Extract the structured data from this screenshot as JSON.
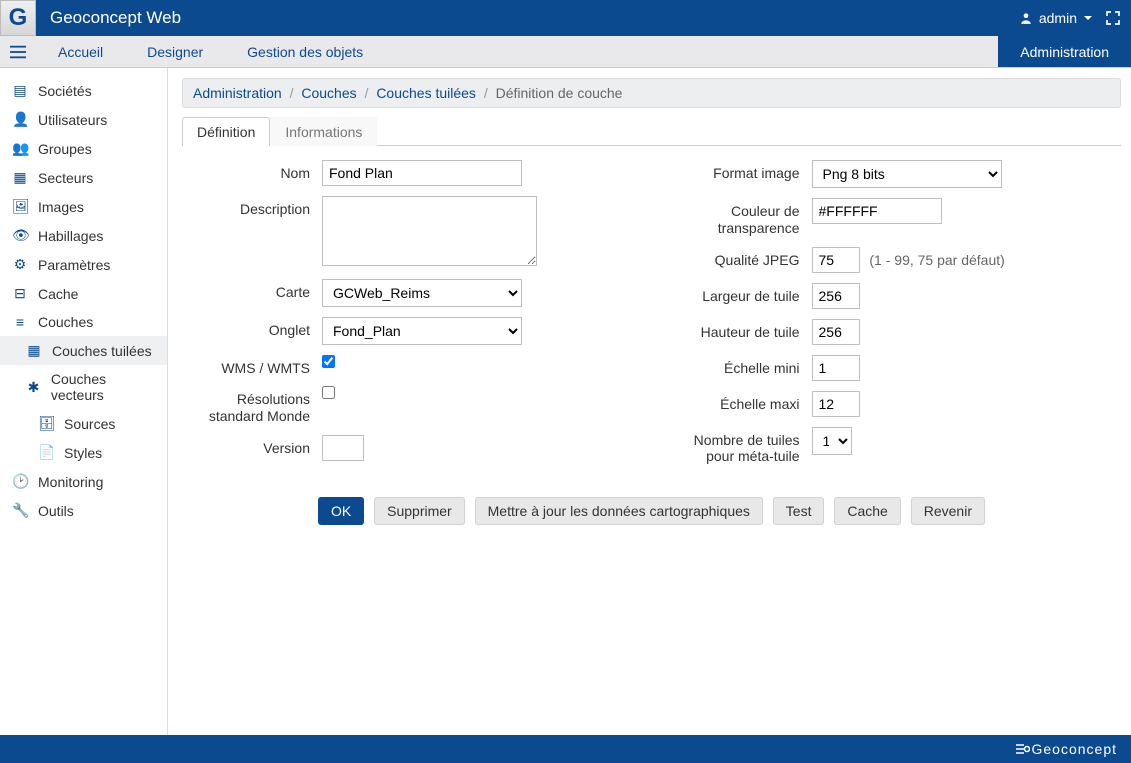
{
  "header": {
    "app_name": "Geoconcept Web",
    "user": "admin"
  },
  "nav": {
    "items": [
      {
        "label": "Accueil",
        "active": false
      },
      {
        "label": "Designer",
        "active": false
      },
      {
        "label": "Gestion des objets",
        "active": false
      },
      {
        "label": "Administration",
        "active": true
      }
    ]
  },
  "sidebar": [
    {
      "label": "Sociétés",
      "icon": "building-icon"
    },
    {
      "label": "Utilisateurs",
      "icon": "user-icon"
    },
    {
      "label": "Groupes",
      "icon": "users-icon"
    },
    {
      "label": "Secteurs",
      "icon": "grid-icon"
    },
    {
      "label": "Images",
      "icon": "image-icon"
    },
    {
      "label": "Habillages",
      "icon": "eye-icon"
    },
    {
      "label": "Paramètres",
      "icon": "gear-icon"
    },
    {
      "label": "Cache",
      "icon": "drive-icon"
    },
    {
      "label": "Couches",
      "icon": "layers-icon"
    },
    {
      "label": "Couches tuilées",
      "icon": "tiles-icon",
      "sub": true,
      "active": true
    },
    {
      "label": "Couches vecteurs",
      "icon": "vector-icon",
      "sub": true
    },
    {
      "label": "Sources",
      "icon": "database-icon",
      "sub2": true
    },
    {
      "label": "Styles",
      "icon": "file-icon",
      "sub2": true
    },
    {
      "label": "Monitoring",
      "icon": "clock-icon"
    },
    {
      "label": "Outils",
      "icon": "wrench-icon"
    }
  ],
  "breadcrumb": {
    "parts": [
      "Administration",
      "Couches",
      "Couches tuilées"
    ],
    "current": "Définition de couche"
  },
  "tabs": [
    {
      "label": "Définition",
      "active": true
    },
    {
      "label": "Informations",
      "active": false
    }
  ],
  "form": {
    "left": {
      "nom_label": "Nom",
      "nom": "Fond Plan",
      "description_label": "Description",
      "description": "",
      "carte_label": "Carte",
      "carte": "GCWeb_Reims",
      "onglet_label": "Onglet",
      "onglet": "Fond_Plan",
      "wms_label": "WMS / WMTS",
      "wms": true,
      "resolutions_label": "Résolutions standard Monde",
      "resolutions": false,
      "version_label": "Version",
      "version": ""
    },
    "right": {
      "format_label": "Format image",
      "format": "Png 8 bits",
      "transparence_label": "Couleur de transparence",
      "transparence": "#FFFFFF",
      "qualite_label": "Qualité JPEG",
      "qualite": "75",
      "qualite_hint": "(1 - 99, 75 par défaut)",
      "largeur_label": "Largeur de tuile",
      "largeur": "256",
      "hauteur_label": "Hauteur de tuile",
      "hauteur": "256",
      "echelle_mini_label": "Échelle mini",
      "echelle_mini": "1",
      "echelle_maxi_label": "Échelle maxi",
      "echelle_maxi": "12",
      "meta_label": "Nombre de tuiles pour méta-tuile",
      "meta": "1"
    }
  },
  "buttons": {
    "ok": "OK",
    "supprimer": "Supprimer",
    "mettre_a_jour": "Mettre à jour les données cartographiques",
    "test": "Test",
    "cache": "Cache",
    "revenir": "Revenir"
  },
  "footer": {
    "brand": "Geoconcept"
  }
}
